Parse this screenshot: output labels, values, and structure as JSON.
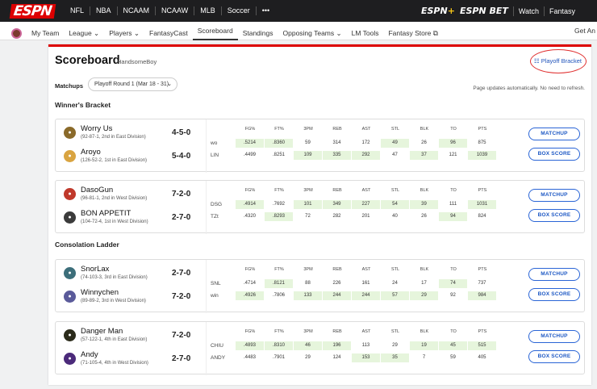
{
  "topnav": {
    "logo": "ESPN",
    "items": [
      "NFL",
      "NBA",
      "NCAAM",
      "NCAAW",
      "MLB",
      "Soccer",
      "•••"
    ],
    "espn_plus": "ESPN",
    "espn_bet": "ESPN BET",
    "watch": "Watch",
    "fantasy": "Fantasy"
  },
  "subnav": {
    "items": [
      "My Team",
      "League ⌄",
      "Players ⌄",
      "FantasyCast",
      "Scoreboard",
      "Standings",
      "Opposing Teams ⌄",
      "LM Tools",
      "Fantasy Store ⧉"
    ],
    "active": "Scoreboard",
    "get_app": "Get An"
  },
  "page": {
    "title": "Scoreboard",
    "owner": "HandsomeBoy",
    "playoff_link": "Playoff Bracket",
    "matchups_label": "Matchups",
    "dropdown_value": "Playoff Round 1 (Mar 18 - 31)",
    "auto_note": "Page updates automatically. No need to refresh."
  },
  "stat_headers": [
    "FG%",
    "FT%",
    "3PM",
    "REB",
    "AST",
    "STL",
    "BLK",
    "TO",
    "PTS"
  ],
  "buttons": {
    "matchup": "MATCHUP",
    "box_score": "BOX SCORE"
  },
  "sections": [
    {
      "title": "Winner's Bracket",
      "matchups": [
        {
          "teams": [
            {
              "name": "Worry Us",
              "record": "(92-87-1, 2nd in East Division)",
              "score": "4-5-0",
              "abbr": "wo",
              "avatar_color": "#8a6a2a",
              "stats": [
                ".5214",
                ".8360",
                "59",
                "314",
                "172",
                "49",
                "26",
                "96",
                "875"
              ],
              "wins": [
                1,
                1,
                0,
                0,
                0,
                1,
                0,
                1,
                0
              ]
            },
            {
              "name": "Aroyo",
              "record": "(126-52-2, 1st in East Division)",
              "score": "5-4-0",
              "abbr": "LIN",
              "avatar_color": "#d9a441",
              "stats": [
                ".4499",
                ".8251",
                "109",
                "335",
                "292",
                "47",
                "37",
                "121",
                "1039"
              ],
              "wins": [
                0,
                0,
                1,
                1,
                1,
                0,
                1,
                0,
                1
              ]
            }
          ]
        },
        {
          "teams": [
            {
              "name": "DasoGun",
              "record": "(96-81-1, 2nd in West Division)",
              "score": "7-2-0",
              "abbr": "DSG",
              "avatar_color": "#c0392b",
              "stats": [
                ".4914",
                ".7692",
                "101",
                "349",
                "227",
                "54",
                "39",
                "111",
                "1031"
              ],
              "wins": [
                1,
                0,
                1,
                1,
                1,
                1,
                1,
                0,
                1
              ]
            },
            {
              "name": "BON APPETIT",
              "record": "(104-72-4, 1st in West Division)",
              "score": "2-7-0",
              "abbr": "TZt",
              "avatar_color": "#3b3b3b",
              "stats": [
                ".4320",
                ".8293",
                "72",
                "282",
                "201",
                "40",
                "26",
                "94",
                "824"
              ],
              "wins": [
                0,
                1,
                0,
                0,
                0,
                0,
                0,
                1,
                0
              ]
            }
          ]
        }
      ]
    },
    {
      "title": "Consolation Ladder",
      "matchups": [
        {
          "teams": [
            {
              "name": "SnorLax",
              "record": "(74-103-3, 3rd in East Division)",
              "score": "2-7-0",
              "abbr": "SNL",
              "avatar_color": "#3c6e7a",
              "stats": [
                ".4714",
                ".8121",
                "88",
                "226",
                "161",
                "24",
                "17",
                "74",
                "737"
              ],
              "wins": [
                0,
                1,
                0,
                0,
                0,
                0,
                0,
                1,
                0
              ]
            },
            {
              "name": "Winnychen",
              "record": "(89-89-2, 3rd in West Division)",
              "score": "7-2-0",
              "abbr": "win",
              "avatar_color": "#5a5a9a",
              "stats": [
                ".4926",
                ".7806",
                "133",
                "244",
                "244",
                "57",
                "29",
                "92",
                "984"
              ],
              "wins": [
                1,
                0,
                1,
                1,
                1,
                1,
                1,
                0,
                1
              ]
            }
          ]
        },
        {
          "teams": [
            {
              "name": "Danger Man",
              "record": "(57-122-1, 4th in East Division)",
              "score": "7-2-0",
              "abbr": "CHIU",
              "avatar_color": "#2b2b1b",
              "stats": [
                ".4893",
                ".8310",
                "46",
                "196",
                "113",
                "29",
                "19",
                "45",
                "515"
              ],
              "wins": [
                1,
                1,
                1,
                1,
                0,
                0,
                1,
                1,
                1
              ]
            },
            {
              "name": "Andy",
              "record": "(71-105-4, 4th in West Division)",
              "score": "2-7-0",
              "abbr": "ANDY",
              "avatar_color": "#4b2a7a",
              "stats": [
                ".4483",
                ".7901",
                "29",
                "124",
                "153",
                "35",
                "7",
                "59",
                "405"
              ],
              "wins": [
                0,
                0,
                0,
                0,
                1,
                1,
                0,
                0,
                0
              ]
            }
          ]
        }
      ]
    }
  ]
}
